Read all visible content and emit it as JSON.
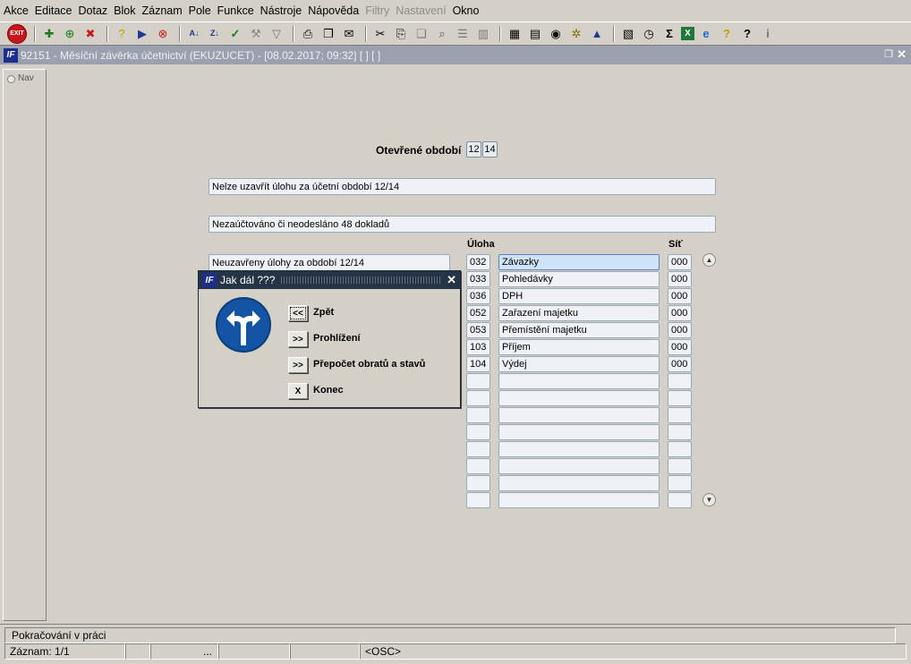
{
  "menubar": {
    "items": [
      {
        "label": "Akce",
        "enabled": true
      },
      {
        "label": "Editace",
        "enabled": true
      },
      {
        "label": "Dotaz",
        "enabled": true
      },
      {
        "label": "Blok",
        "enabled": true
      },
      {
        "label": "Záznam",
        "enabled": true
      },
      {
        "label": "Pole",
        "enabled": true
      },
      {
        "label": "Funkce",
        "enabled": true
      },
      {
        "label": "Nástroje",
        "enabled": true
      },
      {
        "label": "Nápověda",
        "enabled": true
      },
      {
        "label": "Filtry",
        "enabled": false
      },
      {
        "label": "Nastavení",
        "enabled": false
      },
      {
        "label": "Okno",
        "enabled": true
      }
    ]
  },
  "toolbar": {
    "exit_label": "EXIT",
    "icons": [
      "new-record-icon",
      "new-record-tree-icon",
      "delete-record-icon",
      "query-icon",
      "query-execute-icon",
      "query-cancel-icon",
      "sort-ascending-icon",
      "sort-descending-icon",
      "commit-checkmark-icon",
      "tools-icon",
      "filter-icon",
      "print-icon",
      "print-preview-icon",
      "mail-icon",
      "cut-icon",
      "paste-icon",
      "copy-icon",
      "find-icon",
      "list-icon",
      "columns-icon",
      "calculator-icon",
      "document-icon",
      "globe-icon",
      "settings-wheel-icon",
      "chart-icon",
      "image-icon",
      "clock-icon",
      "sum-icon",
      "excel-icon",
      "explorer-icon",
      "help-index-icon",
      "help-icon",
      "info-icon"
    ]
  },
  "window": {
    "title": "92151 - Měsíční závěrka účetnictví (EKUZUCET) - [08.02.2017; 09:32]  [ ]  [ ]",
    "nav_label": "Nav"
  },
  "form": {
    "open_periods_label": "Otevřené období",
    "open_period_month": "12",
    "open_period_year": "14",
    "message_1": "Nelze uzavřít úlohu za účetní období 12/14",
    "message_2": "Nezaúčtováno či neodesláno 48 dokladů",
    "message_3": "Neuzavřeny úlohy za období 12/14",
    "col_task": "Úloha",
    "col_net": "Síť",
    "tasks": [
      {
        "code": "032",
        "name": "Závazky",
        "net": "000"
      },
      {
        "code": "033",
        "name": "Pohledávky",
        "net": "000"
      },
      {
        "code": "036",
        "name": "DPH",
        "net": "000"
      },
      {
        "code": "052",
        "name": "Zařazení majetku",
        "net": "000"
      },
      {
        "code": "053",
        "name": "Přemístění majetku",
        "net": "000"
      },
      {
        "code": "103",
        "name": "Příjem",
        "net": "000"
      },
      {
        "code": "104",
        "name": "Výdej",
        "net": "000"
      }
    ]
  },
  "dialog": {
    "title": "Jak dál ???",
    "buttons": [
      {
        "symbol": "<<",
        "label": "Zpět"
      },
      {
        "symbol": ">>",
        "label": "Prohlížení"
      },
      {
        "symbol": ">>",
        "label": "Přepočet obratů a stavů"
      },
      {
        "symbol": "X",
        "label": "Konec"
      }
    ]
  },
  "status": {
    "message": "Pokračování v práci",
    "record": "Záznam: 1/1",
    "seg_dots": "...",
    "mode": "<OSC>"
  }
}
